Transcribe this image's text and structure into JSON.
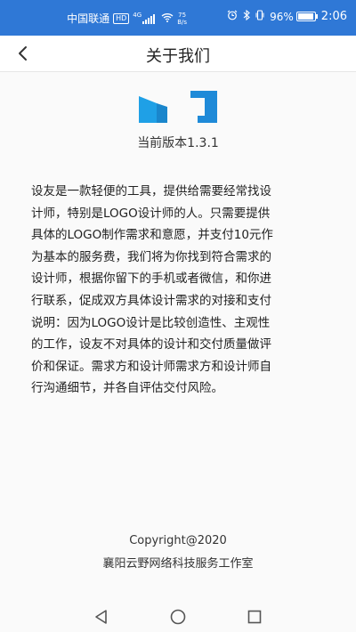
{
  "status_bar": {
    "carrier": "中国联通",
    "hd_badge": "HD",
    "net_type": "4G",
    "speed_value": "75",
    "speed_unit": "B/s",
    "battery": "96%",
    "time": "2:06",
    "color": "#2f78d6"
  },
  "nav": {
    "back_icon": "chevron-left-icon",
    "title": "关于我们"
  },
  "app": {
    "logo_colors": [
      "#1fa0e6",
      "#1f7fd6"
    ],
    "version": "当前版本1.3.1",
    "description_lines": [
      "设友是一款轻便的工具，提供给需要经常找设",
      "计师，特别是LOGO设计师的人。只需要提供",
      "具体的LOGO制作需求和意愿，并支付10元作",
      "为基本的服务费，我们将为你找到符合需求的",
      "设计师，根据你留下的手机或者微信，和你进",
      "行联系，促成双方具体设计需求的对接和支付",
      "说明：因为LOGO设计是比较创造性、主观性",
      "的工作，设友不对具体的设计和交付质量做评",
      "价和保证。需求方和设计师需求方和设计师自",
      "行沟通细节，并各自评估交付风险。"
    ]
  },
  "footer": {
    "copyright": "Copyright@2020",
    "company": "襄阳云野网络科技服务工作室"
  },
  "system_nav": {
    "back": "triangle-back-icon",
    "home": "circle-home-icon",
    "recents": "square-recents-icon"
  }
}
